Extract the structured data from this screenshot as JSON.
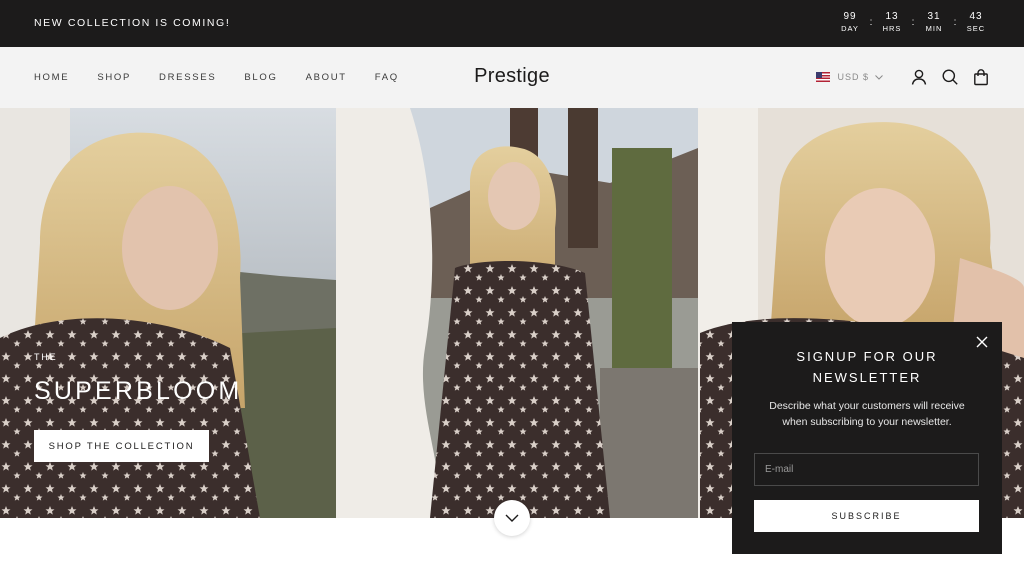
{
  "announcement": {
    "text": "NEW COLLECTION IS COMING!",
    "countdown": [
      {
        "value": "99",
        "label": "DAY"
      },
      {
        "value": "13",
        "label": "HRS"
      },
      {
        "value": "31",
        "label": "MIN"
      },
      {
        "value": "43",
        "label": "SEC"
      }
    ],
    "separator": ":"
  },
  "header": {
    "logo": "Prestige",
    "nav": [
      "HOME",
      "SHOP",
      "DRESSES",
      "BLOG",
      "ABOUT",
      "FAQ"
    ],
    "currency": "USD $",
    "icons": [
      "account-icon",
      "search-icon",
      "cart-icon"
    ]
  },
  "hero": {
    "eyebrow": "THE",
    "title": "SUPERBLOOM",
    "button_label": "SHOP THE COLLECTION"
  },
  "newsletter": {
    "title_line1": "SIGNUP FOR OUR",
    "title_line2": "NEWSLETTER",
    "description": "Describe what your customers will receive when subscribing to your newsletter.",
    "email_placeholder": "E-mail",
    "email_value": "",
    "submit_label": "SUBSCRIBE"
  },
  "colors": {
    "dark": "#1c1b1b",
    "header_bg": "#f3f3f3",
    "white": "#ffffff"
  }
}
